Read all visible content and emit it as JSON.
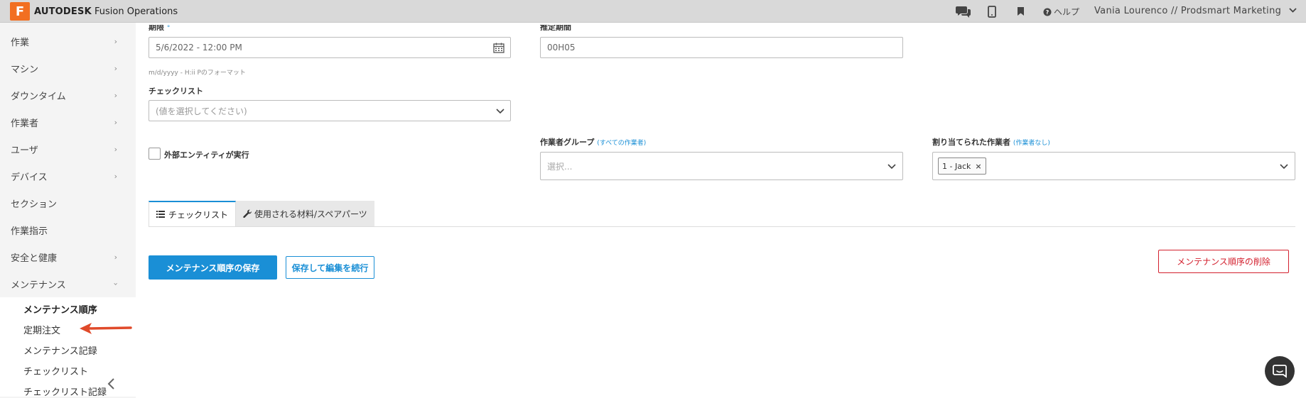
{
  "topbar": {
    "brand_logo_letter": "F",
    "brand_bold": "AUTODESK",
    "brand_rest": " Fusion Operations",
    "help_label": "ヘルプ",
    "user_label": "Vania Lourenco // Prodsmart Marketing"
  },
  "sidebar": {
    "items": [
      {
        "label": "作業"
      },
      {
        "label": "マシン"
      },
      {
        "label": "ダウンタイム"
      },
      {
        "label": "作業者"
      },
      {
        "label": "ユーザ"
      },
      {
        "label": "デバイス"
      },
      {
        "label": "セクション"
      },
      {
        "label": "作業指示"
      },
      {
        "label": "安全と健康"
      },
      {
        "label": "メンテナンス"
      }
    ],
    "sub_items": [
      {
        "label": "メンテナンス順序"
      },
      {
        "label": "定期注文"
      },
      {
        "label": "メンテナンス記録"
      },
      {
        "label": "チェックリスト"
      },
      {
        "label": "チェックリスト記録"
      }
    ]
  },
  "form": {
    "date_label_partial": "期限",
    "date_value": "5/6/2022 - 12:00 PM",
    "date_hint": "m/d/yyyy - H:ii Pのフォーマット",
    "estimate_label_partial": "推定期間",
    "estimate_value": "00H05",
    "checklist_label": "チェックリスト",
    "checklist_placeholder": "(値を選択してください)",
    "external_label": "外部エンティティが実行",
    "group_label": "作業者グループ",
    "group_link": "(すべての作業者)",
    "group_placeholder": "選択...",
    "assigned_label": "割り当てられた作業者",
    "assigned_link": "(作業者なし)",
    "assigned_tag": "1 - Jack"
  },
  "tabs": [
    {
      "label": "チェックリスト"
    },
    {
      "label": "使用される材料/スペアパーツ"
    }
  ],
  "buttons": {
    "save": "メンテナンス順序の保存",
    "save_continue": "保存して編集を続行",
    "delete": "メンテナンス順序の削除"
  },
  "colors": {
    "accent": "#1a8fd6",
    "danger": "#d3202e",
    "brand_orange": "#f26f21",
    "arrow": "#e04a2a"
  }
}
